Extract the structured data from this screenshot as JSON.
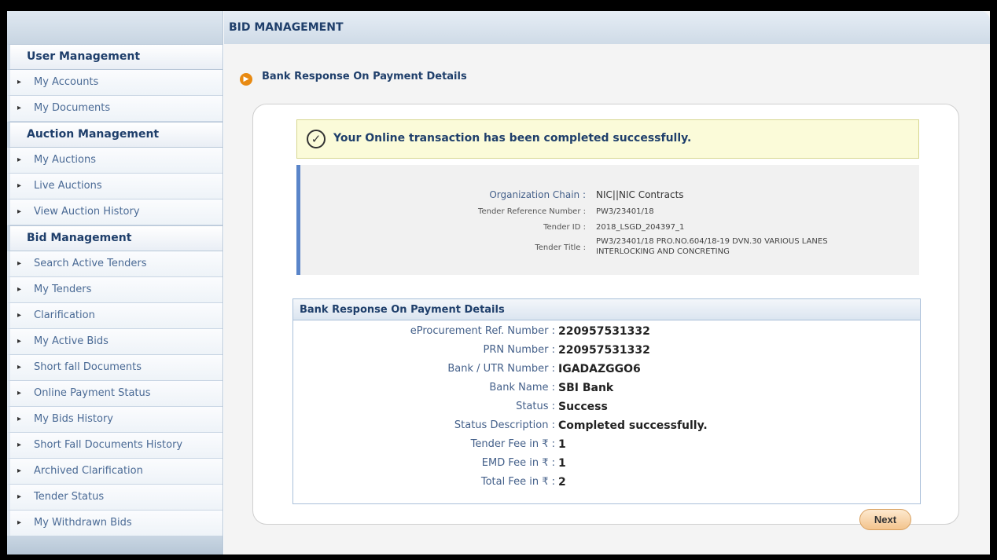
{
  "main": {
    "header": "BID MANAGEMENT",
    "page_heading": "Bank Response On Payment Details",
    "success_message": "Your Online transaction has been completed successfully.",
    "next_label": "Next"
  },
  "sidebar": {
    "sections": [
      {
        "title": "User Management",
        "items": [
          "My Accounts",
          "My Documents"
        ]
      },
      {
        "title": "Auction Management",
        "items": [
          "My Auctions",
          "Live Auctions",
          "View Auction History"
        ]
      },
      {
        "title": "Bid Management",
        "items": [
          "Search Active Tenders",
          "My Tenders",
          "Clarification",
          "My Active Bids",
          "Short fall Documents",
          "Online Payment Status",
          "My Bids History",
          "Short Fall Documents History",
          "Archived Clarification",
          "Tender Status",
          "My Withdrawn Bids"
        ]
      }
    ]
  },
  "tender": {
    "org_chain_label": "Organization Chain :",
    "org_chain_value": "NIC||NIC Contracts",
    "ref_label": "Tender Reference Number :",
    "ref_value": "PW3/23401/18",
    "id_label": "Tender ID :",
    "id_value": "2018_LSGD_204397_1",
    "title_label": "Tender Title :",
    "title_line1": "PW3/23401/18 PRO.NO.604/18-19 DVN.30 VARIOUS LANES",
    "title_line2": "INTERLOCKING AND CONCRETING"
  },
  "payment": {
    "heading": "Bank Response On Payment Details",
    "rows": [
      {
        "label": "eProcurement Ref. Number :",
        "value": "220957531332"
      },
      {
        "label": "PRN Number :",
        "value": "220957531332"
      },
      {
        "label": "Bank / UTR Number :",
        "value": "IGADAZGGO6"
      },
      {
        "label": "Bank Name :",
        "value": "SBI Bank"
      },
      {
        "label": "Status :",
        "value": "Success"
      },
      {
        "label": "Status Description :",
        "value": "Completed successfully."
      },
      {
        "label": "Tender Fee in ₹ :",
        "value": "1"
      },
      {
        "label": "EMD Fee in ₹ :",
        "value": "1"
      },
      {
        "label": "Total Fee in ₹ :",
        "value": "2"
      }
    ]
  },
  "colors": {
    "accent": "#1f3f6b",
    "success_bg": "#fbfbd9",
    "next_button": "#f3c48d"
  }
}
